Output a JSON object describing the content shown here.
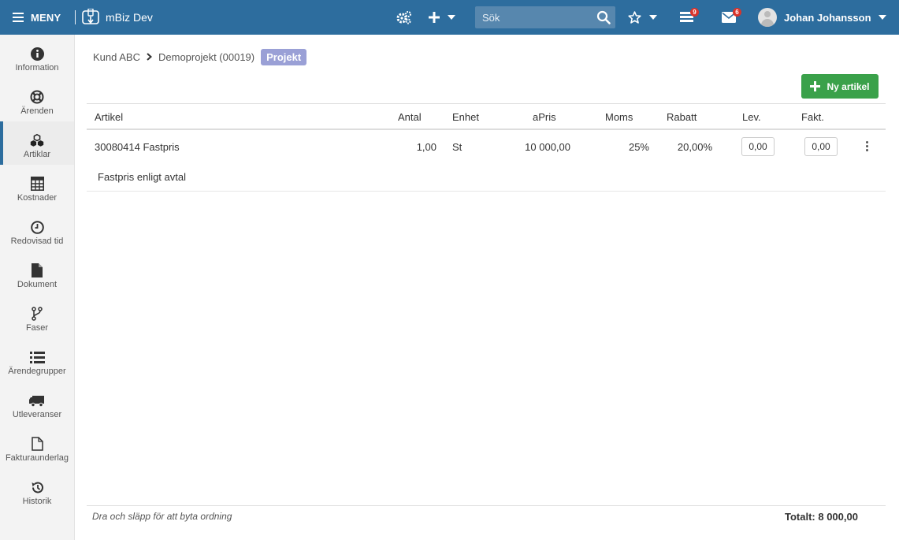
{
  "header": {
    "menu_label": "MENY",
    "app_name": "mBiz Dev",
    "search_placeholder": "Sök",
    "list_badge": "9",
    "mail_badge": "6",
    "user_name": "Johan Johansson"
  },
  "sidebar": {
    "items": [
      {
        "label": "Information",
        "icon": "info-icon"
      },
      {
        "label": "Ärenden",
        "icon": "lifebuoy-icon"
      },
      {
        "label": "Artiklar",
        "icon": "cubes-icon",
        "active": true
      },
      {
        "label": "Kostnader",
        "icon": "calculator-icon"
      },
      {
        "label": "Redovisad tid",
        "icon": "clock-icon"
      },
      {
        "label": "Dokument",
        "icon": "document-icon"
      },
      {
        "label": "Faser",
        "icon": "branch-icon"
      },
      {
        "label": "Ärendegrupper",
        "icon": "list-icon"
      },
      {
        "label": "Utleveranser",
        "icon": "truck-icon"
      },
      {
        "label": "Fakturaunderlag",
        "icon": "file-icon"
      },
      {
        "label": "Historik",
        "icon": "history-icon"
      }
    ]
  },
  "breadcrumb": {
    "customer": "Kund ABC",
    "project": "Demoprojekt (00019)",
    "tag": "Projekt"
  },
  "new_article_label": "Ny artikel",
  "table": {
    "columns": [
      "Artikel",
      "Antal",
      "Enhet",
      "aPris",
      "Moms",
      "Rabatt",
      "Lev.",
      "Fakt."
    ],
    "rows": [
      {
        "article": "30080414 Fastpris",
        "antal": "1,00",
        "enhet": "St",
        "apris": "10 000,00",
        "moms": "25%",
        "rabatt": "20,00%",
        "lev": "0,00",
        "fakt": "0,00",
        "note": "Fastpris enligt avtal"
      }
    ]
  },
  "footer": {
    "hint": "Dra och släpp för att byta ordning",
    "total": "Totalt: 8 000,00"
  },
  "colors": {
    "topbar": "#2d6d9e",
    "accent_green": "#3aa14a",
    "tag": "#9aa0d6",
    "badge": "#d9342b"
  }
}
